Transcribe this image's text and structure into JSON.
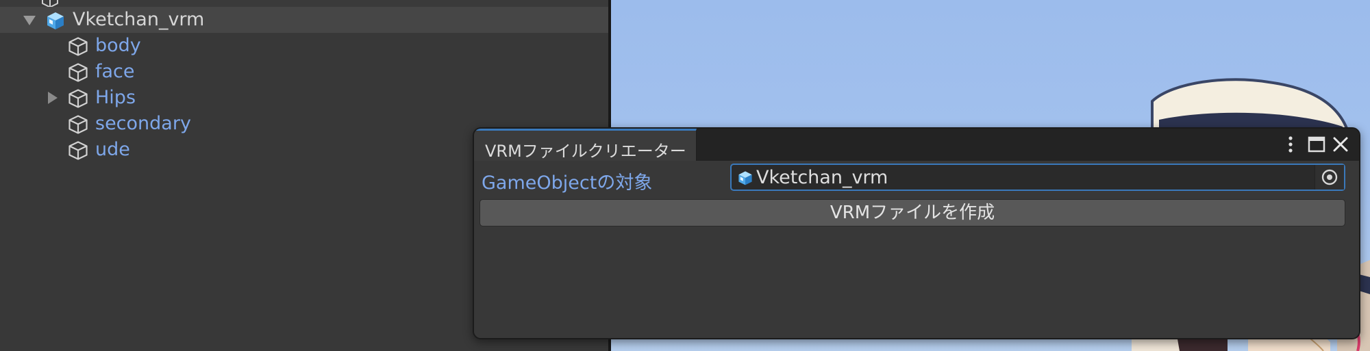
{
  "hierarchy": {
    "clipped_row_label": "・・・",
    "root_object": {
      "label": "Vketchan_vrm",
      "expanded": true
    },
    "children": [
      {
        "label": "body",
        "has_children": false
      },
      {
        "label": "face",
        "has_children": false
      },
      {
        "label": "Hips",
        "has_children": true
      },
      {
        "label": "secondary",
        "has_children": false
      },
      {
        "label": "ude",
        "has_children": false
      }
    ]
  },
  "window": {
    "tab_title": "VRMファイルクリエーター",
    "controls": [
      "more-options-icon",
      "maximize-icon",
      "close-icon"
    ],
    "field_label": "GameObjectの対象",
    "field_value": "Vketchan_vrm",
    "field_icon": "prefab-cube-icon",
    "picker_icon": "object-picker-icon",
    "button_label": "VRMファイルを作成"
  },
  "colors": {
    "panel_bg": "#383838",
    "titlebar_bg": "#232323",
    "accent": "#3a79bb",
    "link_text": "#7ea7ea",
    "sky": "#a4c2ee",
    "button_bg": "#585858"
  }
}
